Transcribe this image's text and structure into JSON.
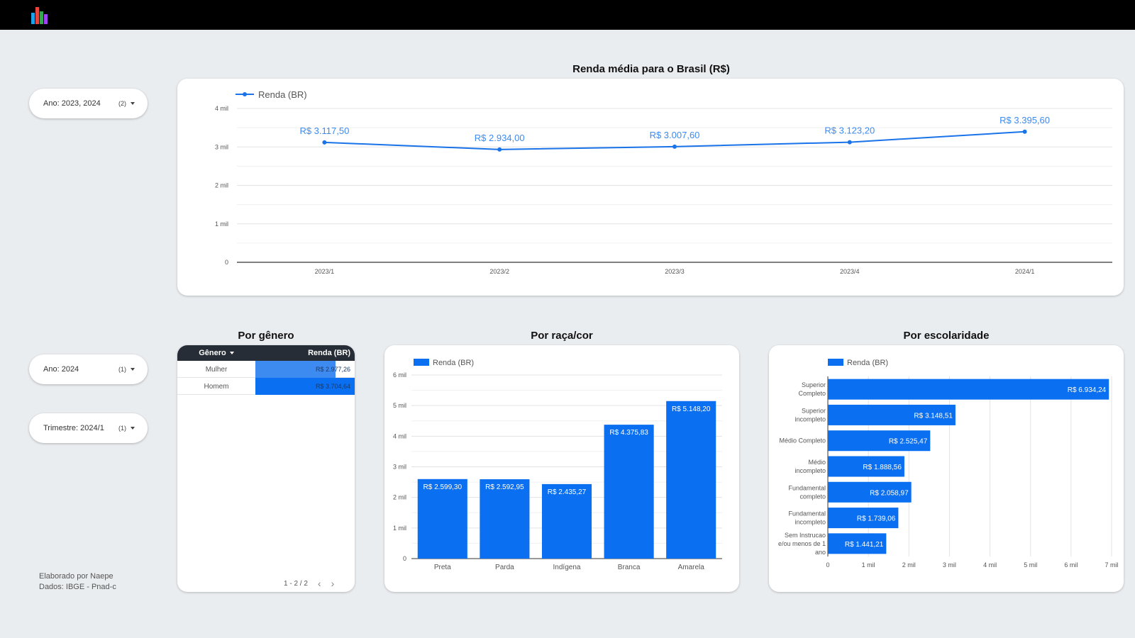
{
  "colors": {
    "accent": "#1a73e8",
    "bar": "#0a6ff0",
    "header_dark": "#262d36"
  },
  "logo": {
    "icon": "bar-chart-logo-icon"
  },
  "filters": [
    {
      "key": "Ano",
      "value": "2023, 2024",
      "count": "(2)"
    },
    {
      "key": "Ano",
      "value": "2024",
      "count": "(1)"
    },
    {
      "key": "Trimestre",
      "value": "2024/1",
      "count": "(1)"
    }
  ],
  "titles": {
    "brasil": "Renda média para o Brasil (R$)",
    "genero": "Por gênero",
    "raca": "Por raça/cor",
    "escolaridade": "Por escolaridade"
  },
  "footer": {
    "line1": "Elaborado por Naepe",
    "line2": "Dados: IBGE - Pnad-c"
  },
  "gender_table": {
    "headers": {
      "genero": "Gênero",
      "renda": "Renda (BR)"
    },
    "rows": [
      {
        "label": "Mulher",
        "value": "R$ 2.977,26",
        "amount": 2977.26
      },
      {
        "label": "Homem",
        "value": "R$ 3.704,64",
        "amount": 3704.64
      }
    ],
    "pagination": "1 - 2 / 2"
  },
  "chart_data": [
    {
      "type": "line",
      "title": "Renda média para o Brasil (R$)",
      "legend": "Renda (BR)",
      "categories": [
        "2023/1",
        "2023/2",
        "2023/3",
        "2023/4",
        "2024/1"
      ],
      "values": [
        3117.5,
        2934.0,
        3007.6,
        3123.2,
        3395.6
      ],
      "labels": [
        "R$ 3.117,50",
        "R$ 2.934,00",
        "R$ 3.007,60",
        "R$ 3.123,20",
        "R$ 3.395,60"
      ],
      "yticks": [
        "0",
        "1 mil",
        "2 mil",
        "3 mil",
        "4 mil"
      ],
      "ylim": [
        0,
        4000
      ],
      "grid": true
    },
    {
      "type": "bar",
      "title": "Por raça/cor",
      "legend": "Renda (BR)",
      "categories": [
        "Preta",
        "Parda",
        "Indígena",
        "Branca",
        "Amarela"
      ],
      "values": [
        2599.3,
        2592.95,
        2435.27,
        4375.83,
        5148.2
      ],
      "labels": [
        "R$ 2.599,30",
        "R$ 2.592,95",
        "R$ 2.435,27",
        "R$ 4.375,83",
        "R$ 5.148,20"
      ],
      "yticks": [
        "0",
        "1 mil",
        "2 mil",
        "3 mil",
        "4 mil",
        "5 mil",
        "6 mil"
      ],
      "ylim": [
        0,
        6000
      ],
      "grid": true
    },
    {
      "type": "bar",
      "orientation": "horizontal",
      "title": "Por escolaridade",
      "legend": "Renda (BR)",
      "categories": [
        [
          "Superior",
          "Completo"
        ],
        [
          "Superior",
          "incompleto"
        ],
        [
          "Médio Completo"
        ],
        [
          "Médio",
          "incompleto"
        ],
        [
          "Fundamental",
          "completo"
        ],
        [
          "Fundamental",
          "incompleto"
        ],
        [
          "Sem Instrucao",
          "e/ou menos de 1",
          "ano"
        ]
      ],
      "values": [
        6934.24,
        3148.51,
        2525.47,
        1888.56,
        2058.97,
        1739.06,
        1441.21
      ],
      "labels": [
        "R$ 6.934,24",
        "R$ 3.148,51",
        "R$ 2.525,47",
        "R$ 1.888,56",
        "R$ 2.058,97",
        "R$ 1.739,06",
        "R$ 1.441,21"
      ],
      "xticks": [
        "0",
        "1 mil",
        "2 mil",
        "3 mil",
        "4 mil",
        "5 mil",
        "6 mil",
        "7 mil"
      ],
      "xlim": [
        0,
        7000
      ],
      "grid": true
    }
  ]
}
